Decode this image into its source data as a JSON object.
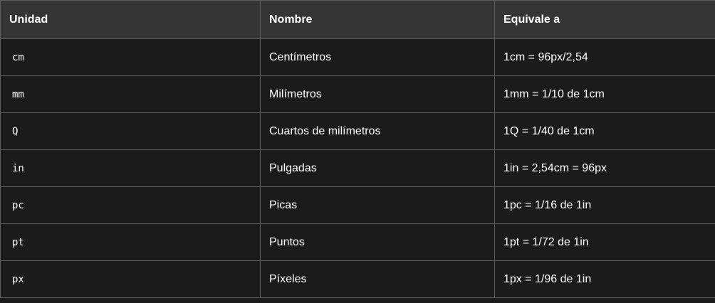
{
  "table": {
    "headers": [
      "Unidad",
      "Nombre",
      "Equivale a"
    ],
    "rows": [
      {
        "unit": "cm",
        "name": "Centímetros",
        "equivalent": "1cm = 96px/2,54"
      },
      {
        "unit": "mm",
        "name": "Milímetros",
        "equivalent": "1mm = 1/10 de 1cm"
      },
      {
        "unit": "Q",
        "name": "Cuartos de milímetros",
        "equivalent": "1Q = 1/40 de 1cm"
      },
      {
        "unit": "in",
        "name": "Pulgadas",
        "equivalent": "1in = 2,54cm = 96px"
      },
      {
        "unit": "pc",
        "name": "Picas",
        "equivalent": "1pc = 1/16 de 1in"
      },
      {
        "unit": "pt",
        "name": "Puntos",
        "equivalent": "1pt = 1/72 de 1in"
      },
      {
        "unit": "px",
        "name": "Píxeles",
        "equivalent": "1px = 1/96 de 1in"
      }
    ]
  }
}
